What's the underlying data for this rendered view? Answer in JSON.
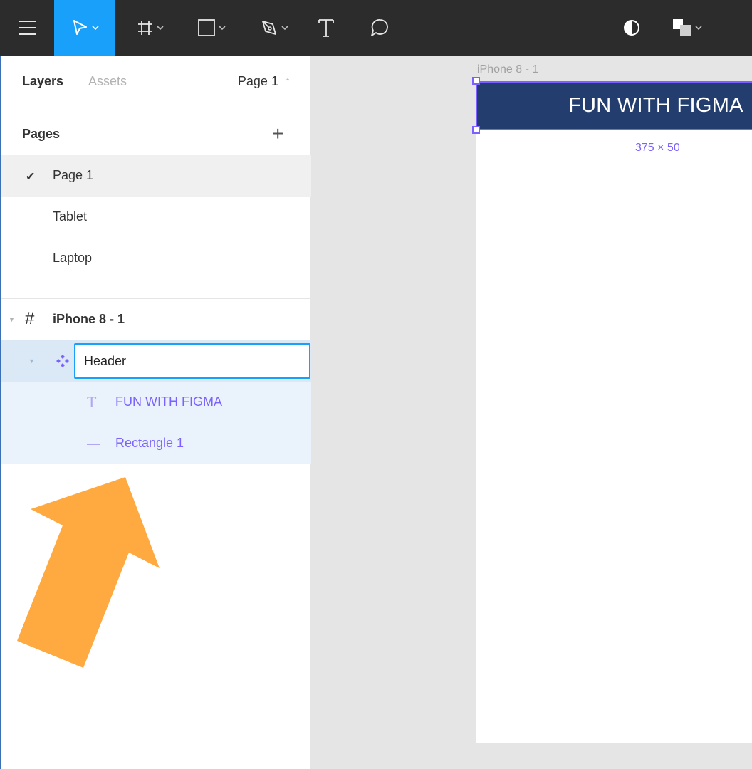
{
  "toolbar": {
    "tools": [
      "menu-icon",
      "move-tool-icon",
      "frame-tool-icon",
      "rectangle-tool-icon",
      "pen-tool-icon",
      "text-tool-icon",
      "comment-tool-icon",
      "contrast-icon",
      "component-icon"
    ],
    "active_tool": "move",
    "accent": "#18a0fb"
  },
  "panel": {
    "tabs": {
      "layers": "Layers",
      "assets": "Assets"
    },
    "current_page": "Page 1",
    "pages_title": "Pages",
    "pages": [
      {
        "label": "Page 1",
        "active": true
      },
      {
        "label": "Tablet",
        "active": false
      },
      {
        "label": "Laptop",
        "active": false
      }
    ],
    "layers": {
      "frame": "iPhone 8 - 1",
      "component_rename_value": "Header",
      "children": [
        {
          "label": "FUN WITH FIGMA",
          "icon": "text-layer-icon"
        },
        {
          "label": "Rectangle 1",
          "icon": "rectangle-layer-icon"
        }
      ]
    }
  },
  "canvas": {
    "frame_name": "iPhone 8 - 1",
    "header_text": "FUN WITH FIGMA",
    "selection_size": "375 × 50",
    "header_color": "#233d6e",
    "selection_color": "#7b61ff"
  },
  "annotation": {
    "arrow_color": "#ffaa40",
    "icon": "arrow-up-right-icon"
  }
}
